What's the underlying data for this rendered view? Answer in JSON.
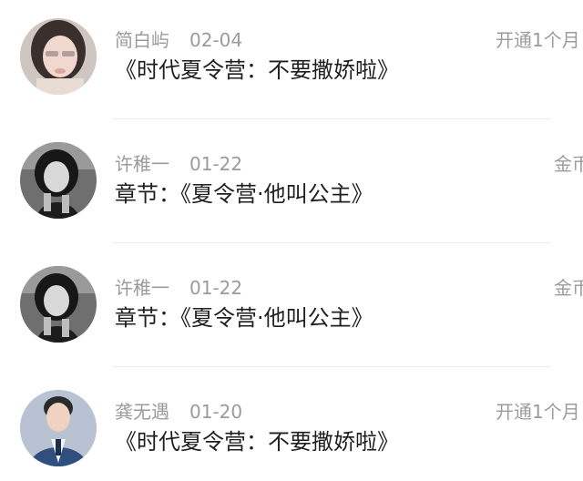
{
  "items": [
    {
      "name": "简白屿",
      "date": "02-04",
      "right_text": "开通1个月",
      "content": "《时代夏令营：不要撒娇啦》",
      "avatar_icon": "avatar-girl-blurred-icon"
    },
    {
      "name": "许稚一",
      "date": "01-22",
      "right_text": "金币",
      "content": "章节：《夏令营·他叫公主》",
      "avatar_icon": "avatar-girl-dark-icon"
    },
    {
      "name": "许稚一",
      "date": "01-22",
      "right_text": "金币",
      "content": "章节：《夏令营·他叫公主》",
      "avatar_icon": "avatar-girl-dark-icon"
    },
    {
      "name": "龚无遇",
      "date": "01-20",
      "right_text": "开通1个月",
      "content": "《时代夏令营：不要撒娇啦》",
      "avatar_icon": "avatar-man-suit-icon"
    }
  ]
}
